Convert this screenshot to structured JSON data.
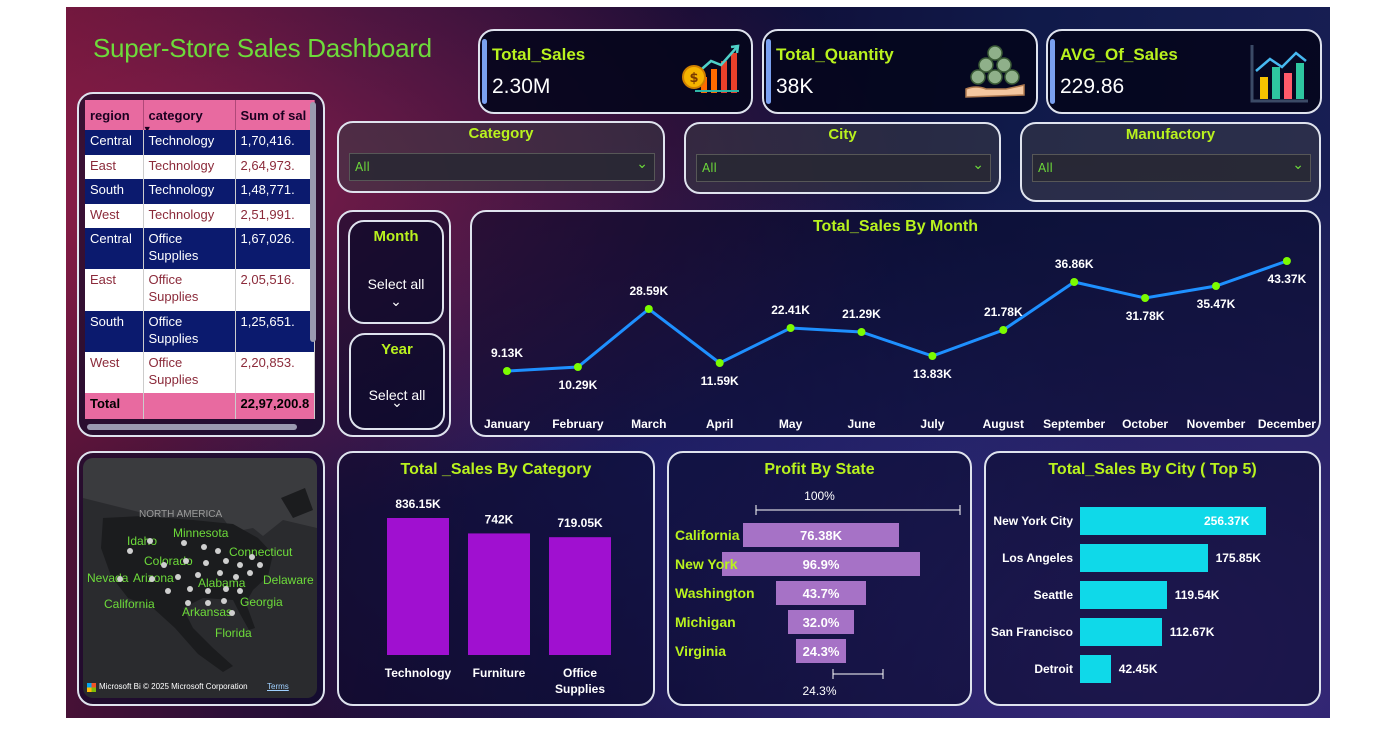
{
  "dashboard": {
    "title": "Super-Store Sales Dashboard"
  },
  "kpis": [
    {
      "label": "Total_Sales",
      "value": "2.30M",
      "icon": "growth-chart-icon"
    },
    {
      "label": "Total_Quantity",
      "value": "38K",
      "icon": "coins-hand-icon"
    },
    {
      "label": "AVG_Of_Sales",
      "value": "229.86",
      "icon": "bar-chart-icon"
    }
  ],
  "slicers": {
    "category": {
      "title": "Category",
      "value": "All"
    },
    "city": {
      "title": "City",
      "value": "All"
    },
    "manufactory": {
      "title": "Manufactory",
      "value": "All"
    },
    "month": {
      "title": "Month",
      "value": "Select all"
    },
    "year": {
      "title": "Year",
      "value": "Select all"
    }
  },
  "matrix": {
    "headers": [
      "region",
      "category",
      "Sum of sal"
    ],
    "rows": [
      {
        "region": "Central",
        "category": "Technology",
        "sum": "1,70,416.",
        "style": "dark"
      },
      {
        "region": "East",
        "category": "Technology",
        "sum": "2,64,973.",
        "style": "light"
      },
      {
        "region": "South",
        "category": "Technology",
        "sum": "1,48,771.",
        "style": "dark"
      },
      {
        "region": "West",
        "category": "Technology",
        "sum": "2,51,991.",
        "style": "light"
      },
      {
        "region": "Central",
        "category": "Office Supplies",
        "sum": "1,67,026.",
        "style": "dark"
      },
      {
        "region": "East",
        "category": "Office Supplies",
        "sum": "2,05,516.",
        "style": "light"
      },
      {
        "region": "South",
        "category": "Office Supplies",
        "sum": "1,25,651.",
        "style": "dark"
      },
      {
        "region": "West",
        "category": "Office Supplies",
        "sum": "2,20,853.",
        "style": "light"
      }
    ],
    "total": {
      "label": "Total",
      "sum": "22,97,200.8"
    }
  },
  "map": {
    "region_label": "NORTH AMERICA",
    "states": [
      "Minnesota",
      "Idaho",
      "Connecticut",
      "Colorado",
      "Nevada",
      "Arizona",
      "Alabama",
      "Delaware",
      "California",
      "Georgia",
      "Arkansas",
      "Florida"
    ],
    "copyright": "© 2025 Microsoft Corporation",
    "terms": "Terms",
    "brand": "Microsoft Bi"
  },
  "charts": {
    "month_title": "Total_Sales By Month",
    "category_title": "Total _Sales By Category",
    "state_title": "Profit By State",
    "city_title": "Total_Sales By City ( Top 5)"
  },
  "chart_data": [
    {
      "type": "line",
      "title": "Total_Sales By Month",
      "categories": [
        "January",
        "February",
        "March",
        "April",
        "May",
        "June",
        "July",
        "August",
        "September",
        "October",
        "November",
        "December"
      ],
      "values": [
        9.13,
        10.29,
        28.59,
        11.59,
        22.41,
        21.29,
        13.83,
        21.78,
        36.86,
        31.78,
        35.47,
        43.37
      ],
      "labels": [
        "9.13K",
        "10.29K",
        "28.59K",
        "11.59K",
        "22.41K",
        "21.29K",
        "13.83K",
        "21.78K",
        "36.86K",
        "31.78K",
        "35.47K",
        "43.37K"
      ],
      "color": "#1e90ff",
      "marker_color": "#7cfc00"
    },
    {
      "type": "bar",
      "title": "Total _Sales By Category",
      "categories": [
        "Technology",
        "Furniture",
        "Office Supplies"
      ],
      "values": [
        836.15,
        742,
        719.05
      ],
      "labels": [
        "836.15K",
        "742K",
        "719.05K"
      ],
      "color": "#a010d0"
    },
    {
      "type": "bar",
      "title": "Profit By State",
      "categories": [
        "California",
        "New York",
        "Washington",
        "Michigan",
        "Virginia"
      ],
      "values": [
        76.38,
        96.9,
        43.7,
        32.0,
        24.3
      ],
      "labels": [
        "76.38K",
        "96.9%",
        "43.7%",
        "32.0%",
        "24.3%"
      ],
      "top_label": "100%",
      "bottom_label": "24.3%",
      "color": "#a672c6"
    },
    {
      "type": "bar",
      "title": "Total_Sales By City ( Top 5)",
      "categories": [
        "New York City",
        "Los Angeles",
        "Seattle",
        "San Francisco",
        "Detroit"
      ],
      "values": [
        256.37,
        175.85,
        119.54,
        112.67,
        42.45
      ],
      "labels": [
        "256.37K",
        "175.85K",
        "119.54K",
        "112.67K",
        "42.45K"
      ],
      "color": "#0fd9e9"
    }
  ]
}
